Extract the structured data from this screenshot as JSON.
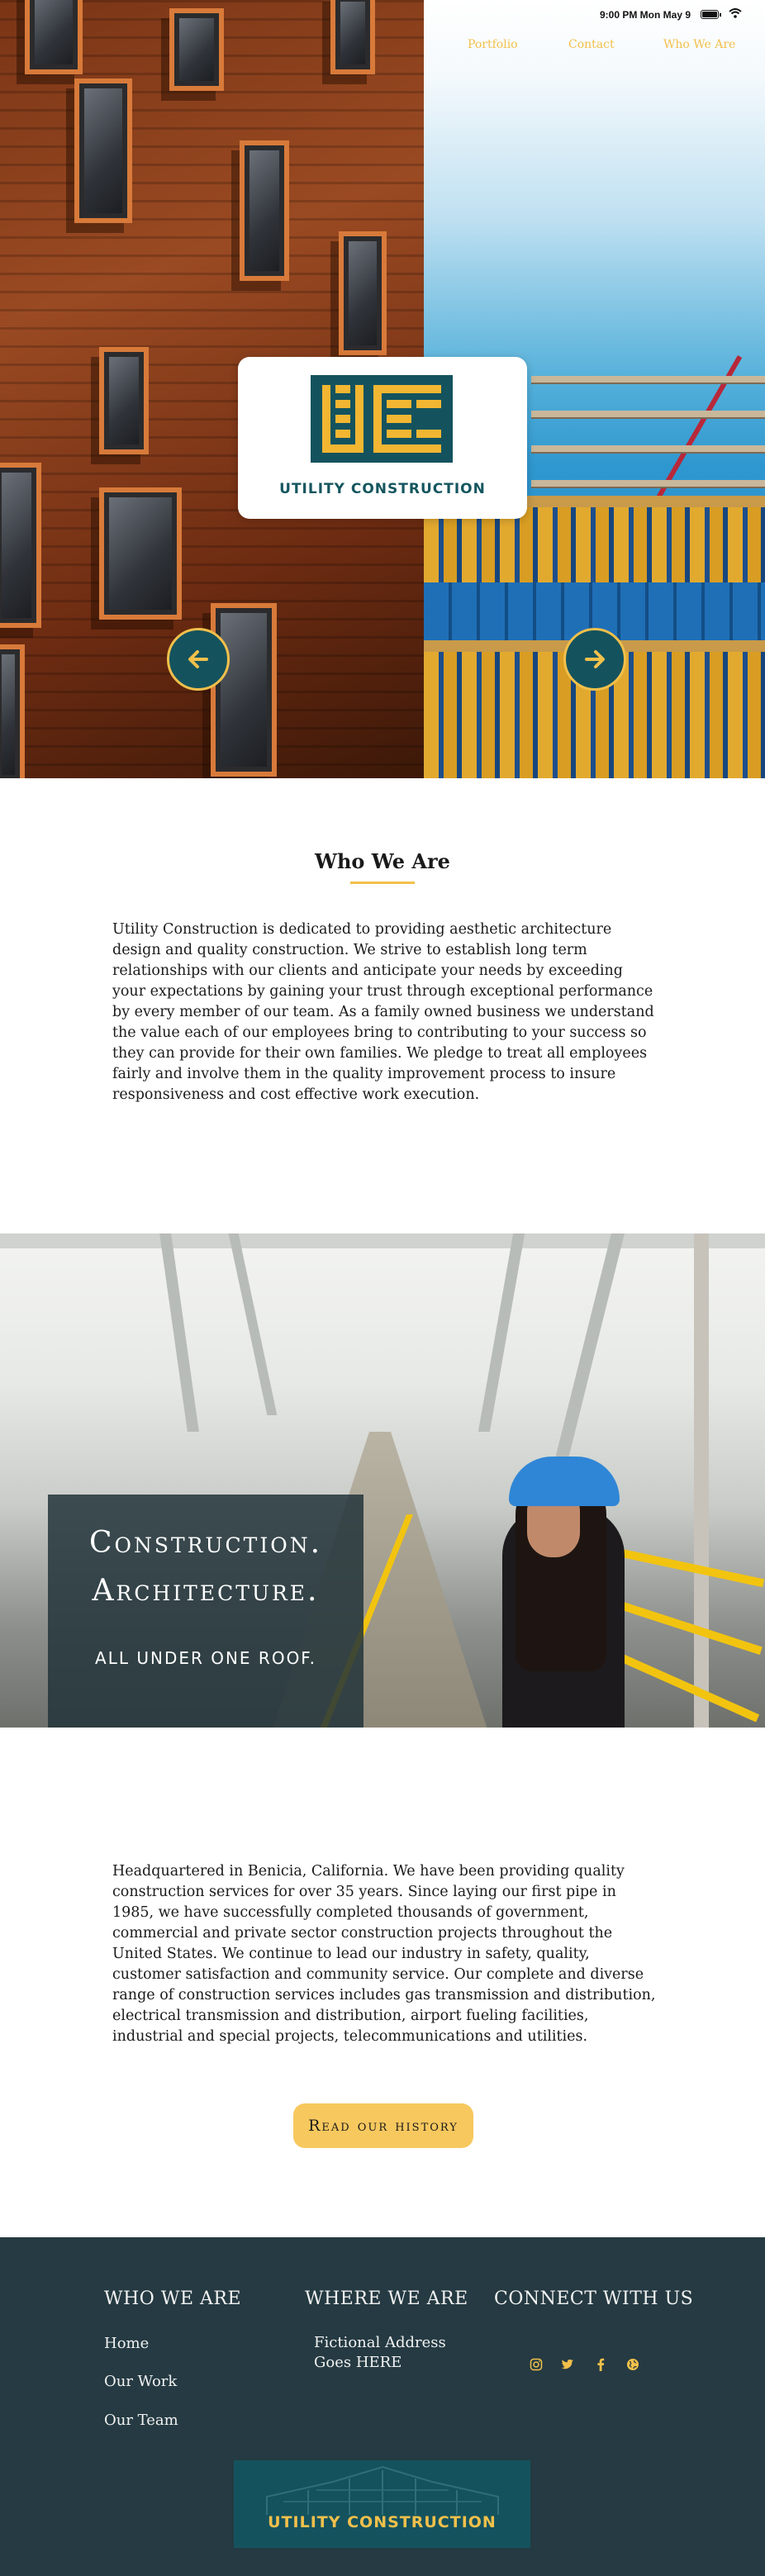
{
  "status_bar": {
    "time": "9:00 PM Mon May 9"
  },
  "nav": {
    "items": [
      "Portfolio",
      "Contact",
      "Who We Are"
    ]
  },
  "hero": {
    "logo_text": "UTILITY CONSTRUCTION"
  },
  "who_we_are": {
    "title": "Who We Are",
    "body": "Utility Construction is dedicated to providing aesthetic architecture design and quality construction. We strive to establish long term relationships with our clients and anticipate your needs by exceeding your expectations by gaining your trust through exceptional performance by every member of our team. As a family owned business we understand the value each of our employees bring to contributing to your success so they can provide for their own families. We pledge to treat all employees fairly and involve them in the quality improvement process to insure responsiveness and cost effective work execution."
  },
  "banner": {
    "line1": "Construction.",
    "line2": "Architecture.",
    "line3": "ALL UNDER ONE ROOF."
  },
  "about": {
    "body": "Headquartered in Benicia, California. We have been providing quality construction services for over 35 years. Since laying our first pipe in 1985, we have successfully completed thousands of government, commercial and private sector construction projects throughout the United States. We continue to lead our industry in safety, quality, customer satisfaction and community service. Our complete and diverse range of construction services includes gas transmission and distribution, electrical transmission and distribution, airport fueling facilities, industrial and special projects, telecommunications and utilities.",
    "button": "Read our history"
  },
  "footer": {
    "col1": {
      "heading": "WHO WE ARE",
      "links": [
        "Home",
        "Our Work",
        "Our Team"
      ]
    },
    "col2": {
      "heading": "WHERE WE ARE",
      "address_line1": "Fictional Address",
      "address_line2": "Goes HERE"
    },
    "col3": {
      "heading": "CONNECT WITH US",
      "icons": [
        "instagram-icon",
        "twitter-icon",
        "facebook-icon",
        "globe-icon"
      ]
    },
    "logo_text": "UTILITY CONSTRUCTION"
  },
  "colors": {
    "accent_yellow": "#f2c04b",
    "brand_teal": "#14535e",
    "footer_bg": "#253a42",
    "button_yellow": "#f7c85e"
  }
}
